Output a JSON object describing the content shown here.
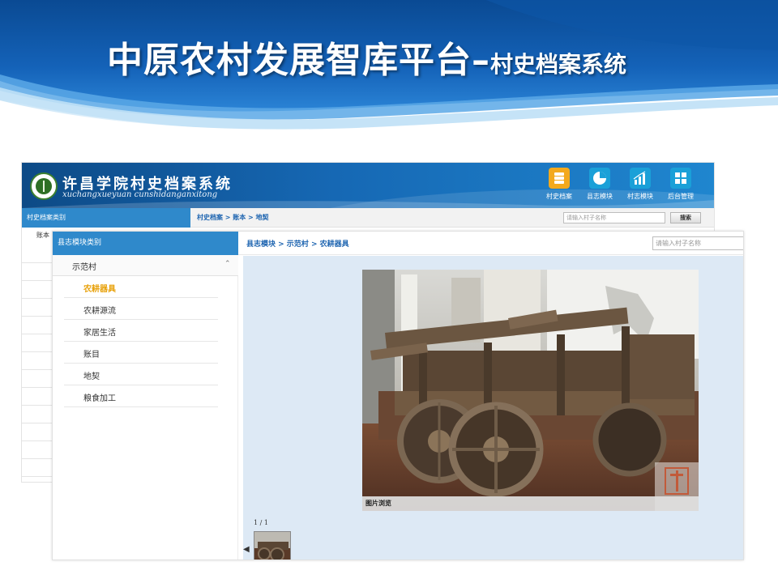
{
  "slide": {
    "title_main": "中原农村发展智库平台",
    "title_dash": "–",
    "title_sub": "村史档案系统"
  },
  "back_window": {
    "school_title": "许昌学院村史档案系统",
    "school_subtitle": "xuchangxueyuan cunshidanganxitong",
    "nav": [
      {
        "label": "村史档案",
        "icon": "archive-icon",
        "color": "#f3a91d"
      },
      {
        "label": "县志模块",
        "icon": "pie-chart-icon",
        "color": "#1aa0d8"
      },
      {
        "label": "村志模块",
        "icon": "bar-chart-icon",
        "color": "#1aa0d8"
      },
      {
        "label": "后台管理",
        "icon": "grid-icon",
        "color": "#1aa0d8"
      }
    ],
    "left_header": "村史档案类别",
    "tree_head": "账本",
    "crumb": "村史档案 > 账本 > 地契",
    "search_placeholder": "请输入村子名称",
    "search_button": "搜索"
  },
  "front_window": {
    "left_header": "县志模块类别",
    "village": "示范村",
    "categories": [
      {
        "label": "农耕器具",
        "active": true
      },
      {
        "label": "农耕源流",
        "active": false
      },
      {
        "label": "家居生活",
        "active": false
      },
      {
        "label": "账目",
        "active": false
      },
      {
        "label": "地契",
        "active": false
      },
      {
        "label": "粮食加工",
        "active": false
      }
    ],
    "crumb": "县志模块 > 示范村 > 农耕器具",
    "search_placeholder": "请输入村子名称",
    "photo_caption": "图片浏览",
    "page_counter": "1 / 1"
  },
  "colors": {
    "banner_blue": "#1668b4",
    "panel_header": "#2f89cb",
    "active_category": "#e8a20c",
    "crumb_link": "#1d64b0",
    "main_bg": "#dde9f5"
  }
}
